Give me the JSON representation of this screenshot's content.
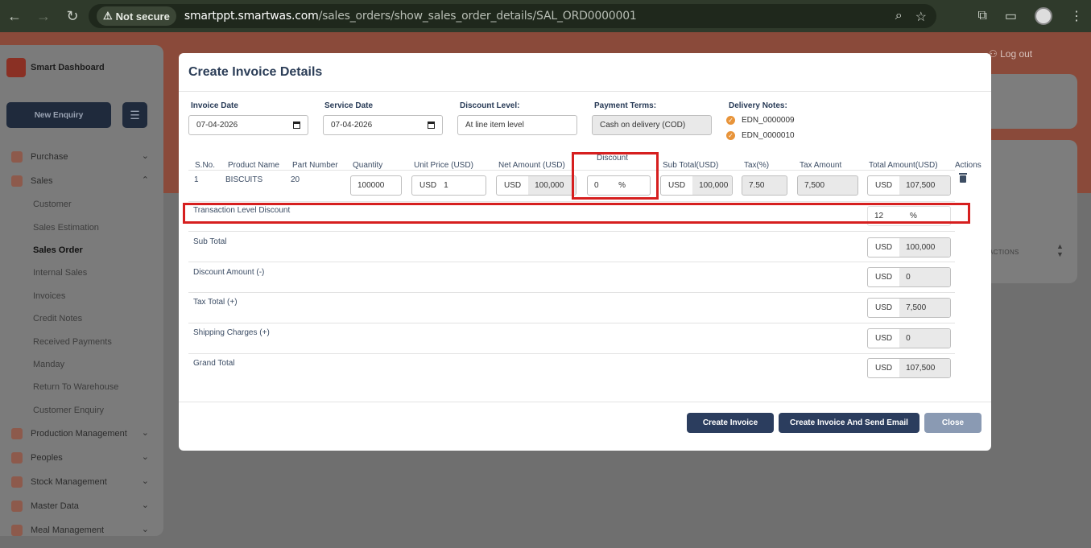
{
  "browser": {
    "not_secure": "Not secure",
    "url_host": "smartppt.smartwas.com",
    "url_path": "/sales_orders/show_sales_order_details/SAL_ORD0000001"
  },
  "app": {
    "brand": "Smart Dashboard",
    "new_enquiry": "New Enquiry",
    "logout": "Log out",
    "bg_actions": "ACTIONS",
    "sidebar": [
      {
        "label": "Purchase",
        "chevron": "v"
      },
      {
        "label": "Sales",
        "chevron": "^"
      }
    ],
    "sales_sub": [
      "Customer",
      "Sales Estimation",
      "Sales Order",
      "Internal Sales",
      "Invoices",
      "Credit Notes",
      "Received Payments",
      "Manday",
      "Return To Warehouse",
      "Customer Enquiry"
    ],
    "sidebar_after": [
      "Production Management",
      "Peoples",
      "Stock Management",
      "Master Data",
      "Meal Management"
    ]
  },
  "modal": {
    "title": "Create Invoice Details",
    "invoice_date_label": "Invoice Date",
    "invoice_date": "07-04-2026",
    "service_date_label": "Service Date",
    "service_date": "07-04-2026",
    "discount_level_label": "Discount Level:",
    "discount_level": "At line item level",
    "payment_terms_label": "Payment Terms:",
    "payment_terms": "Cash on delivery (COD)",
    "delivery_notes_label": "Delivery Notes:",
    "delivery_notes": [
      "EDN_0000009",
      "EDN_0000010"
    ],
    "columns": {
      "sno": "S.No.",
      "product": "Product Name",
      "part": "Part Number",
      "qty": "Quantity",
      "unit_price": "Unit Price (USD)",
      "net_amount": "Net Amount (USD)",
      "discount": "Discount",
      "sub_total": "Sub Total(USD)",
      "tax": "Tax(%)",
      "tax_amount": "Tax Amount",
      "total": "Total Amount(USD)",
      "actions": "Actions"
    },
    "row": {
      "sno": "1",
      "product": "BISCUITS",
      "part": "20",
      "qty": "100000",
      "currency": "USD",
      "unit_price": "1",
      "net_amount": "100,000",
      "discount": "0",
      "discount_unit": "%",
      "sub_total": "100,000",
      "tax": "7.50",
      "tax_amount": "7,500",
      "total": "107,500"
    },
    "summary": {
      "txn_discount_label": "Transaction Level Discount",
      "txn_discount": "12",
      "txn_discount_unit": "%",
      "sub_total_label": "Sub Total",
      "sub_total": "100,000",
      "discount_amount_label": "Discount Amount (-)",
      "discount_amount": "0",
      "tax_total_label": "Tax Total (+)",
      "tax_total": "7,500",
      "shipping_label": "Shipping Charges (+)",
      "shipping": "0",
      "grand_total_label": "Grand Total",
      "grand_total": "107,500",
      "currency": "USD"
    },
    "buttons": {
      "create": "Create Invoice",
      "create_email": "Create Invoice And Send Email",
      "close": "Close"
    }
  }
}
